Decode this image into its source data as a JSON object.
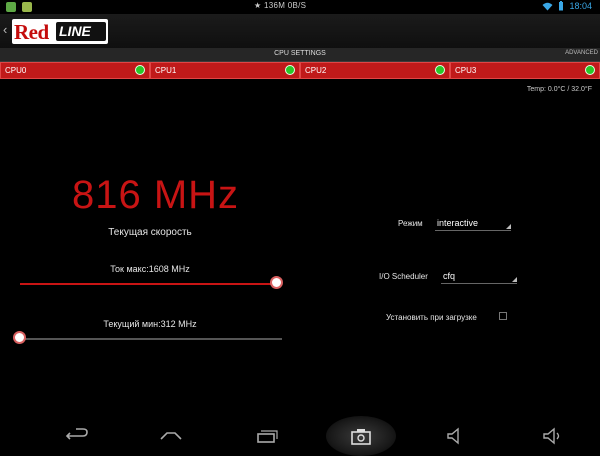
{
  "status_bar": {
    "center_text": "136M 0B/S",
    "time": "18:04"
  },
  "action_bar": {
    "logo_text_red": "Red",
    "logo_text_white": "LINE"
  },
  "section": {
    "title": "CPU SETTINGS",
    "advanced_label": "ADVANCED"
  },
  "cpu_tabs": [
    {
      "label": "CPU0"
    },
    {
      "label": "CPU1"
    },
    {
      "label": "CPU2"
    },
    {
      "label": "CPU3"
    }
  ],
  "temperature": "Temp: 0.0°C / 32.0°F",
  "speed": {
    "value": "816 MHz",
    "caption": "Текущая скорость"
  },
  "max_slider": {
    "label": "Ток макс:1608 MHz",
    "fraction": 0.98
  },
  "min_slider": {
    "label": "Текущий мин:312 MHz",
    "fraction": 0.0
  },
  "governor": {
    "label": "Режим",
    "value": "interactive"
  },
  "scheduler": {
    "label": "I/O Scheduler",
    "value": "cfq"
  },
  "boot": {
    "label": "Установить при загрузке",
    "checked": false
  },
  "colors": {
    "accent": "#c81414",
    "status_blue": "#3aa7e6",
    "indicator_green": "#29c829"
  },
  "navbar_icons": [
    "back-icon",
    "home-icon",
    "recent-apps-icon",
    "screenshot-icon",
    "volume-down-icon",
    "volume-up-icon"
  ]
}
